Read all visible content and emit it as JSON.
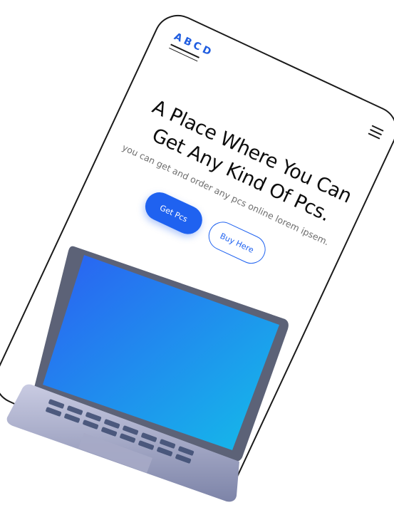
{
  "brand": {
    "logo": "ABCD"
  },
  "hero": {
    "title_line1": "A Place Where You Can",
    "title_line2": "Get Any Kind Of Pcs.",
    "subtitle": "you can get and order any pcs online lorem ipsem."
  },
  "buttons": {
    "primary": "Get Pcs",
    "secondary": "Buy Here"
  },
  "colors": {
    "accent": "#1f62f0",
    "screen_top": "#2b63f2",
    "screen_bottom": "#16b8ea"
  },
  "icons": {
    "menu": "hamburger-icon"
  }
}
